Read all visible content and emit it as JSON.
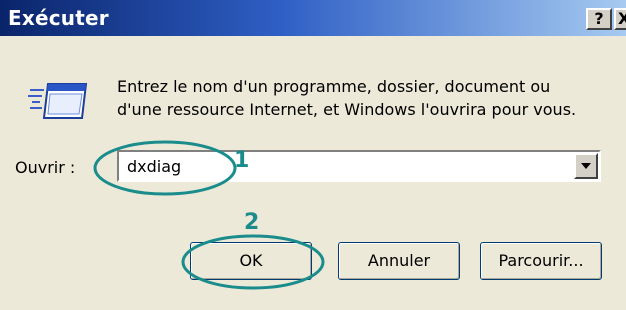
{
  "window": {
    "title": "Exécuter",
    "help_label": "?",
    "close_label": "X"
  },
  "icon": "run-dialog-icon",
  "description": {
    "line1": "Entrez le nom d'un programme, dossier, document ou",
    "line2": "d'une ressource Internet, et Windows l'ouvrira pour vous."
  },
  "open_field": {
    "label": "Ouvrir :",
    "value": "dxdiag"
  },
  "buttons": {
    "ok": "OK",
    "cancel": "Annuler",
    "browse": "Parcourir..."
  },
  "annotations": {
    "step1": "1",
    "step2": "2",
    "color": "#1a8c8c"
  }
}
